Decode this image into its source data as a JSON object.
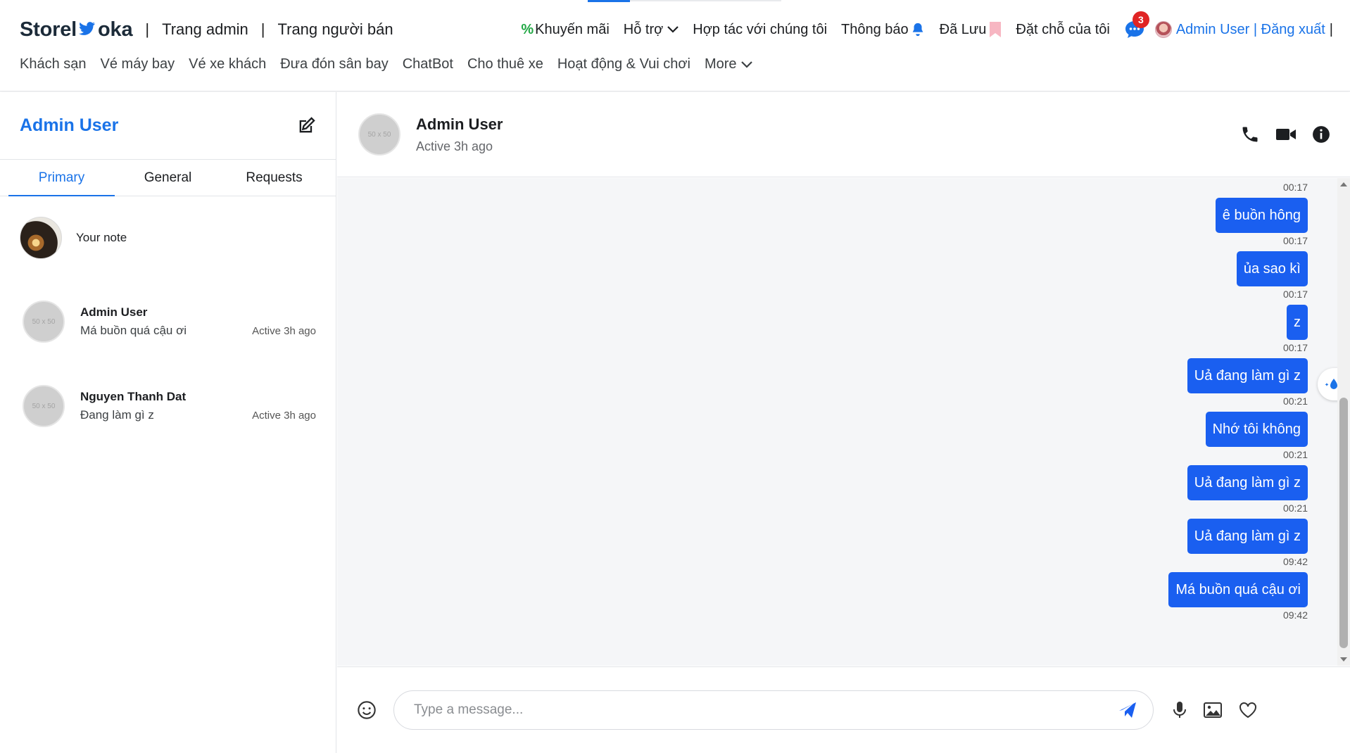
{
  "header": {
    "logo_left": "Storel",
    "logo_right": "oka",
    "admin_link": "Trang admin",
    "seller_link": "Trang người bán",
    "separator": "|",
    "nav_right": {
      "promo": "Khuyến mãi",
      "support": "Hỗ trợ",
      "partner": "Hợp tác với chúng tôi",
      "notifications": "Thông báo",
      "saved": "Đã Lưu",
      "bookings": "Đặt chỗ của tôi",
      "chat_badge": "3",
      "user_label": "Admin User | Đăng xuất",
      "end_pipe": "|"
    },
    "nav_secondary": [
      "Khách sạn",
      "Vé máy bay",
      "Vé xe khách",
      "Đưa đón sân bay",
      "ChatBot",
      "Cho thuê xe",
      "Hoạt động & Vui chơi",
      "More"
    ]
  },
  "sidebar": {
    "title": "Admin User",
    "tabs": [
      "Primary",
      "General",
      "Requests"
    ],
    "active_tab": "Primary",
    "note_label": "Your note",
    "placeholder_avatar_text": "50 x 50",
    "conversations": [
      {
        "name": "Admin User",
        "last_message": "Má buồn quá cậu ơi",
        "status": "Active 3h ago"
      },
      {
        "name": "Nguyen Thanh Dat",
        "last_message": "Đang làm gì z",
        "status": "Active 3h ago"
      }
    ]
  },
  "chat": {
    "name": "Admin User",
    "status": "Active 3h ago",
    "avatar_text": "50 x 50",
    "top_time": "00:17",
    "messages": [
      {
        "text": "ê buồn hông",
        "time": "00:17"
      },
      {
        "text": "ủa sao kì",
        "time": "00:17"
      },
      {
        "text": "z",
        "time": "00:17"
      },
      {
        "text": "Uả đang làm gì z",
        "time": "00:21"
      },
      {
        "text": "Nhớ tôi không",
        "time": "00:21"
      },
      {
        "text": "Uả đang làm gì z",
        "time": "00:21"
      },
      {
        "text": "Uả đang làm gì z",
        "time": "09:42"
      },
      {
        "text": "Má buồn quá cậu ơi",
        "time": "09:42"
      }
    ],
    "input_placeholder": "Type a message..."
  },
  "colors": {
    "accent": "#1a73e8",
    "bubble": "#1a5ff0",
    "badge": "#e02424",
    "chat_bg": "#f5f6f8"
  }
}
